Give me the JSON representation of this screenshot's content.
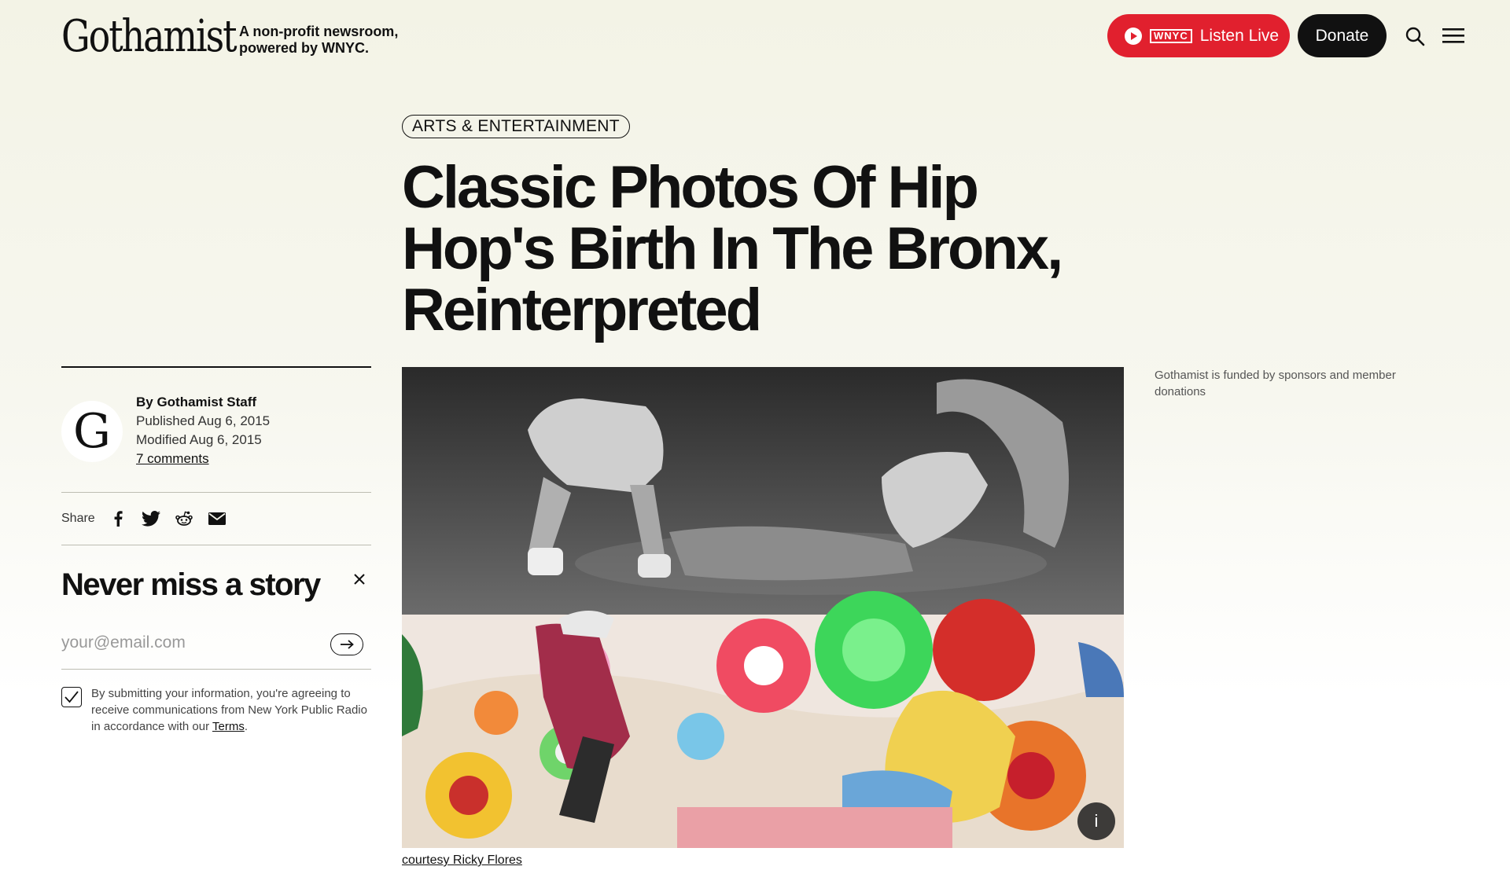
{
  "header": {
    "logo": "Gothamist",
    "tagline_line1": "A non-profit newsroom,",
    "tagline_line2": "powered by WNYC.",
    "listen": {
      "station": "WNYC",
      "label": "Listen Live"
    },
    "donate_label": "Donate"
  },
  "article": {
    "category": "ARTS & ENTERTAINMENT",
    "headline": "Classic Photos Of Hip Hop's Birth In The Bronx, Reinterpreted",
    "byline": {
      "avatar_letter": "G",
      "author": "By Gothamist Staff",
      "published": "Published Aug 6, 2015",
      "modified": "Modified Aug 6, 2015",
      "comments": "7 comments"
    },
    "share": {
      "label": "Share",
      "icons": [
        "facebook-icon",
        "twitter-icon",
        "reddit-icon",
        "email-icon"
      ]
    },
    "image_caption": "courtesy Ricky Flores",
    "info_icon": "i"
  },
  "newsletter": {
    "title": "Never miss a story",
    "email_placeholder": "your@email.com",
    "consent_text": "By submitting your information, you're agreeing to receive communications from New York Public Radio in accordance with our ",
    "terms_label": "Terms",
    "consent_end": ".",
    "checkbox_checked": true
  },
  "sidebar": {
    "sponsor_note": "Gothamist is funded by sponsors and member donations"
  },
  "colors": {
    "accent_red": "#e1202e",
    "dark": "#111111"
  }
}
